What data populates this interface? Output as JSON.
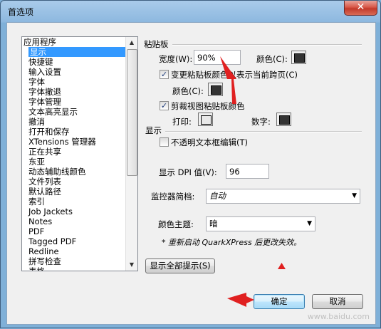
{
  "window": {
    "title": "首选项",
    "close_label": "✕"
  },
  "sidebar": {
    "items": [
      {
        "label": "应用程序",
        "root": true
      },
      {
        "label": "显示",
        "selected": true
      },
      {
        "label": "快捷键"
      },
      {
        "label": "输入设置"
      },
      {
        "label": "字体"
      },
      {
        "label": "字体撤退"
      },
      {
        "label": "字体管理"
      },
      {
        "label": "文本高亮显示"
      },
      {
        "label": "撤消"
      },
      {
        "label": "打开和保存"
      },
      {
        "label": "XTensions 管理器"
      },
      {
        "label": "正在共享"
      },
      {
        "label": "东亚"
      },
      {
        "label": "动态辅助线颜色"
      },
      {
        "label": "文件列表"
      },
      {
        "label": "默认路径"
      },
      {
        "label": "索引"
      },
      {
        "label": "Job Jackets"
      },
      {
        "label": "Notes"
      },
      {
        "label": "PDF"
      },
      {
        "label": "Tagged PDF"
      },
      {
        "label": "Redline"
      },
      {
        "label": "拼写检查"
      },
      {
        "label": "表格"
      }
    ]
  },
  "pasteboard": {
    "section_title": "粘贴板",
    "width_label": "宽度(W):",
    "width_value": "90%",
    "color_label": "颜色(C):",
    "color_value": "#333333",
    "change_color_label": "变更粘贴板颜色以表示当前跨页(C)",
    "change_color_checked": true,
    "sub_color_label": "颜色(C):",
    "sub_color_value": "#333333",
    "clip_label": "剪裁视图粘贴板颜色",
    "clip_checked": true,
    "print_label": "打印:",
    "print_color": "#e8e8e8",
    "digital_label": "数字:",
    "digital_color": "#333333"
  },
  "display": {
    "section_title": "显示",
    "opaque_label": "不透明文本框编辑(T)",
    "opaque_checked": false,
    "dpi_label": "显示 DPI 值(V):",
    "dpi_value": "96",
    "monitor_label": "监控器简档:",
    "monitor_value": "自动",
    "theme_label": "颜色主题:",
    "theme_value": "暗",
    "restart_note": "* 重新启动 QuarkXPress 后更改失效。",
    "show_tips_label": "显示全部提示(S)"
  },
  "footer": {
    "ok_label": "确定",
    "cancel_label": "取消"
  },
  "annotations": {
    "arrow_color": "#e02020",
    "watermark": "www.baidu.com"
  }
}
